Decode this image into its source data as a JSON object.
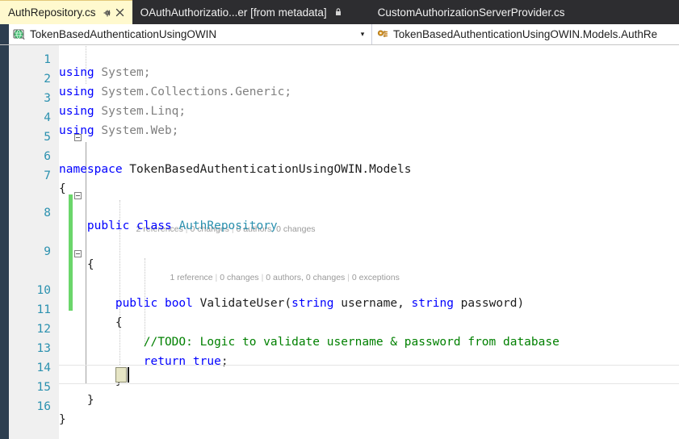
{
  "window": {
    "app": "Visual Studio",
    "theme_accent": "#2D3E50"
  },
  "tabs": [
    {
      "label": "AuthRepository.cs",
      "state": "active",
      "pin_icon": "pin-icon",
      "close_icon": "close-icon"
    },
    {
      "label": "OAuthAuthorizatio...er [from metadata]",
      "state": "inactive",
      "lock_icon": "lock-icon"
    },
    {
      "label": "CustomAuthorizationServerProvider.cs",
      "state": "inactive"
    }
  ],
  "navbar": {
    "project": {
      "icon": "web-project-icon",
      "value": "TokenBasedAuthenticationUsingOWIN",
      "caret": "▾"
    },
    "type": {
      "icon": "class-icon",
      "value": "TokenBasedAuthenticationUsingOWIN.Models.AuthRe"
    }
  },
  "editor": {
    "language": "C#",
    "cursor_line": 15,
    "gutter": {
      "line_numbers": [
        "1",
        "2",
        "3",
        "4",
        "5",
        "6",
        "7",
        "8",
        "9",
        "10",
        "11",
        "12",
        "13",
        "14",
        "15",
        "16"
      ],
      "change_bar_color": "#6BD66B",
      "change_bar_lines": [
        9,
        10,
        11,
        12,
        13,
        14
      ]
    },
    "codelens": [
      {
        "for_line": 8,
        "text": "2 references | 0 changes | 0 authors, 0 changes",
        "parts": [
          "2 references",
          "0 changes",
          "0 authors, 0 changes"
        ]
      },
      {
        "for_line": 10,
        "text": "1 reference | 0 changes | 0 authors, 0 changes | 0 exceptions",
        "parts": [
          "1 reference",
          "0 changes",
          "0 authors, 0 changes",
          "0 exceptions"
        ]
      }
    ],
    "lines": [
      {
        "n": "1",
        "text": "using System;"
      },
      {
        "n": "2",
        "text": "using System.Collections.Generic;"
      },
      {
        "n": "3",
        "text": "using System.Linq;"
      },
      {
        "n": "4",
        "text": "using System.Web;"
      },
      {
        "n": "5",
        "text": ""
      },
      {
        "n": "6",
        "text": "namespace TokenBasedAuthenticationUsingOWIN.Models"
      },
      {
        "n": "7",
        "text": "{"
      },
      {
        "n": "8",
        "text": "    public class AuthRepository"
      },
      {
        "n": "9",
        "text": "    {"
      },
      {
        "n": "10",
        "text": "        public bool ValidateUser(string username, string password)"
      },
      {
        "n": "11",
        "text": "        {"
      },
      {
        "n": "12",
        "text": "            //TODO: Logic to validate username & password from database"
      },
      {
        "n": "13",
        "text": "            return true;"
      },
      {
        "n": "14",
        "text": "        }"
      },
      {
        "n": "15",
        "text": "    }"
      },
      {
        "n": "16",
        "text": "}"
      }
    ],
    "tokens": {
      "line1": {
        "kw": "using",
        "rest": " System;"
      },
      "line2": {
        "kw": "using",
        "rest": " System.Collections.Generic;"
      },
      "line3": {
        "kw": "using",
        "rest": " System.Linq;"
      },
      "line4": {
        "kw": "using",
        "rest": " System.Web;"
      },
      "line6": {
        "kw": "namespace",
        "rest": " TokenBasedAuthenticationUsingOWIN.Models"
      },
      "line7": {
        "text": "{"
      },
      "line8": {
        "kw1": "public",
        "kw2": "class",
        "typ": "AuthRepository"
      },
      "line9": {
        "text": "{"
      },
      "line10": {
        "kw1": "public",
        "kw2": "bool",
        "name": "ValidateUser(",
        "t1": "string",
        "p1": " username, ",
        "t2": "string",
        "p2": " password)"
      },
      "line11": {
        "text": "{"
      },
      "line12": {
        "cmt": "//TODO: Logic to validate username & password from database"
      },
      "line13": {
        "kw1": "return",
        "kw2": "true",
        "semi": ";"
      },
      "line14": {
        "text": "}"
      },
      "line15": {
        "text": "}"
      },
      "line16": {
        "text": "}"
      }
    },
    "colors": {
      "keyword": "#0000FF",
      "type": "#2B91AF",
      "comment": "#008000",
      "plain": "#1E1E1E",
      "linenumber": "#2B91AF",
      "background": "#FFFFFF",
      "gutter_background": "#F0F0F0",
      "brace_match": "#E6E5C5"
    }
  }
}
